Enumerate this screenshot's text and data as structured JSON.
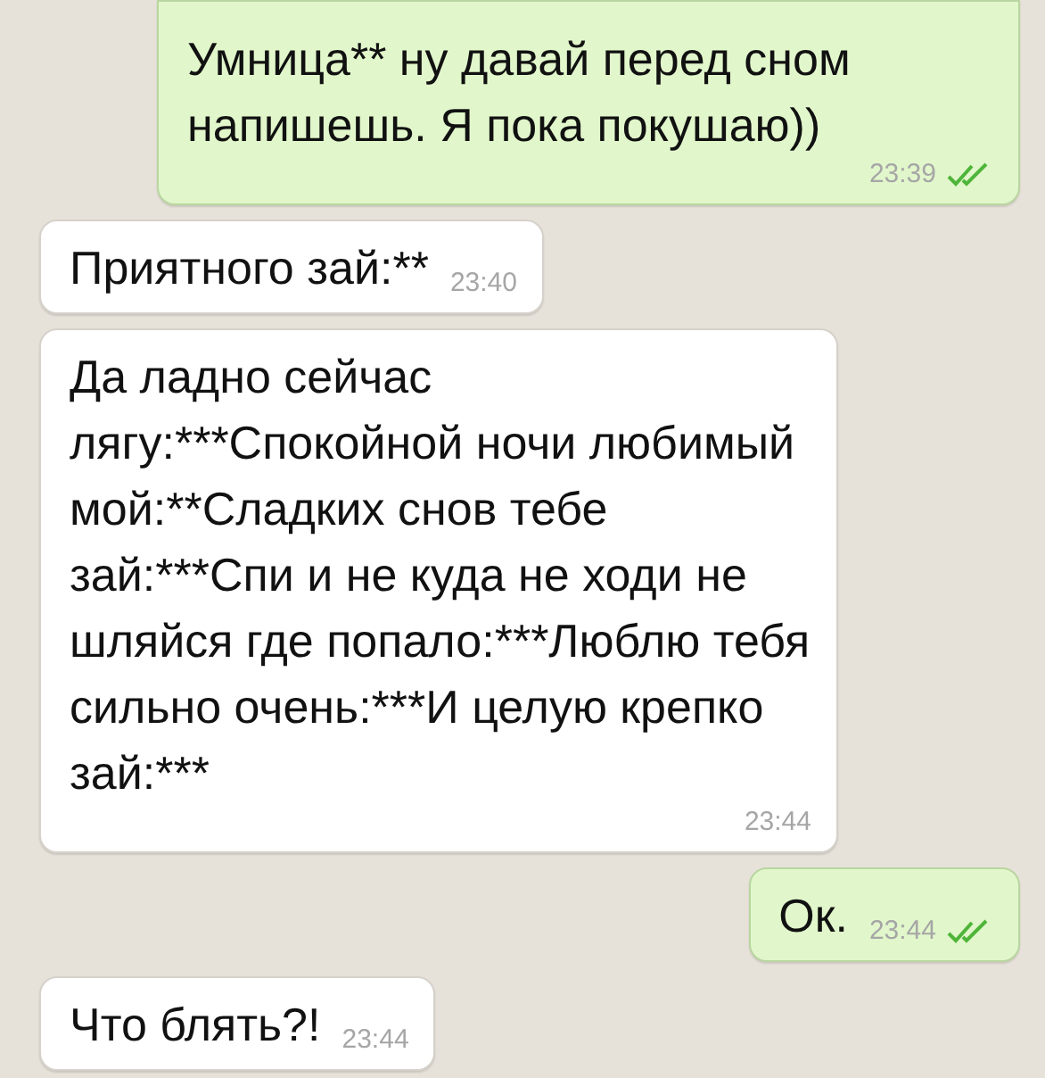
{
  "messages": [
    {
      "kind": "outgoing",
      "text": "Умница** ну давай перед сном напишешь. Я пока покушаю))",
      "time": "23:39",
      "read": true
    },
    {
      "kind": "incoming",
      "text": "Приятного зай:**",
      "time": "23:40"
    },
    {
      "kind": "incoming",
      "text": "Да ладно сейчас лягу:***Спокойной ночи любимый мой:**Сладких снов тебе зай:***Спи и не куда не ходи не шляйся где попало:***Люблю тебя сильно очень:***И целую крепко зай:***",
      "time": "23:44"
    },
    {
      "kind": "outgoing",
      "text": "Ок.",
      "time": "23:44",
      "read": true
    },
    {
      "kind": "incoming",
      "text": "Что блять?!",
      "time": "23:44"
    }
  ]
}
